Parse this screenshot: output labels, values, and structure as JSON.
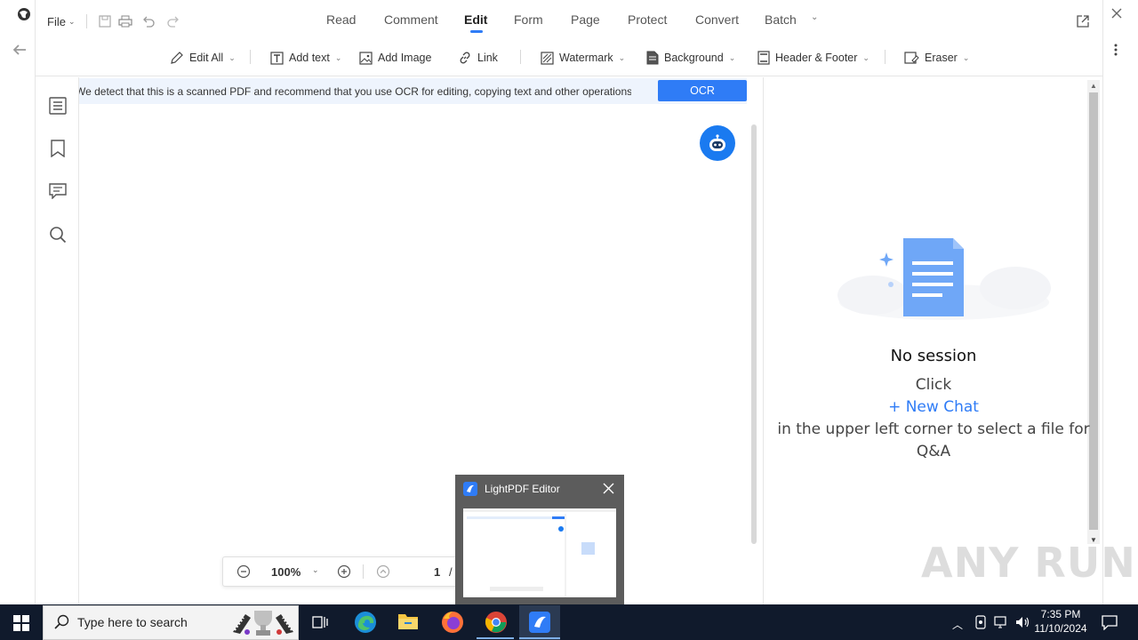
{
  "app": {
    "file_menu": "File",
    "tabs": [
      "Read",
      "Comment",
      "Edit",
      "Form",
      "Page",
      "Protect",
      "Convert",
      "Batch"
    ],
    "active_tab": "Edit"
  },
  "toolbar": {
    "edit_all": "Edit All",
    "add_text": "Add text",
    "add_image": "Add Image",
    "link": "Link",
    "watermark": "Watermark",
    "background": "Background",
    "header_footer": "Header & Footer",
    "eraser": "Eraser"
  },
  "banner": {
    "message": "We detect that this is a scanned PDF and recommend that you use OCR for editing, copying text and other operations",
    "ocr_button": "OCR"
  },
  "zoom": {
    "level": "100%",
    "page_current": "1",
    "page_sep": "/"
  },
  "assistant_panel": {
    "title": "No session",
    "line1": "Click",
    "new_chat": "+ New Chat",
    "line3": "in the upper left corner to select a file for",
    "line4": "Q&A"
  },
  "popup": {
    "title": "LightPDF Editor"
  },
  "taskbar": {
    "search_placeholder": "Type here to search",
    "time": "7:35 PM",
    "date": "11/10/2024"
  },
  "watermark": "ANY RUN",
  "colors": {
    "accent": "#2f7cf6",
    "banner_bg": "#eef4fd",
    "taskbar_bg": "#101a2c"
  }
}
